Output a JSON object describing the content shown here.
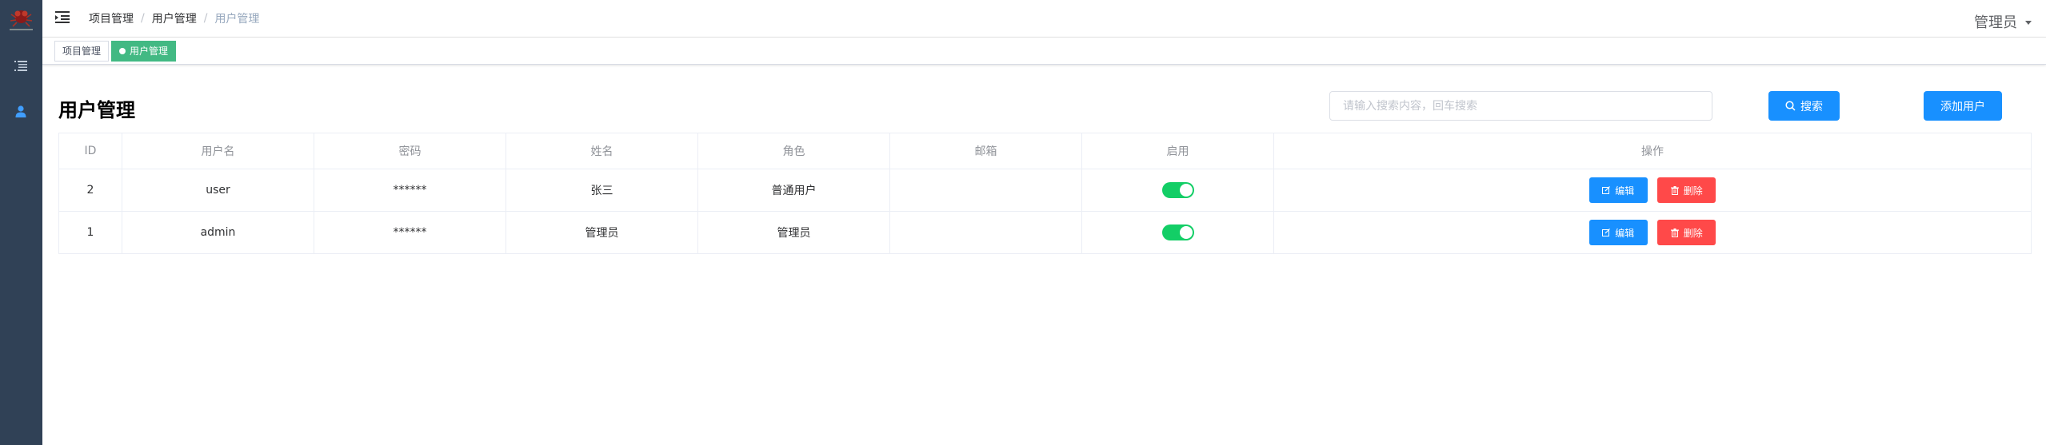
{
  "breadcrumb": [
    "项目管理",
    "用户管理",
    "用户管理"
  ],
  "user_menu": {
    "label": "管理员"
  },
  "tags": [
    {
      "label": "项目管理",
      "active": false
    },
    {
      "label": "用户管理",
      "active": true
    }
  ],
  "page": {
    "title": "用户管理"
  },
  "search": {
    "placeholder": "请输入搜索内容，回车搜索",
    "button_label": "搜索"
  },
  "add_button_label": "添加用户",
  "table": {
    "headers": [
      "ID",
      "用户名",
      "密码",
      "姓名",
      "角色",
      "邮箱",
      "启用",
      "操作"
    ],
    "rows": [
      {
        "id": "2",
        "username": "user",
        "password": "******",
        "name": "张三",
        "role": "普通用户",
        "email": "",
        "enabled": true
      },
      {
        "id": "1",
        "username": "admin",
        "password": "******",
        "name": "管理员",
        "role": "管理员",
        "email": "",
        "enabled": true
      }
    ],
    "edit_label": "编辑",
    "delete_label": "删除"
  },
  "colors": {
    "sidebar": "#304156",
    "primary": "#1890ff",
    "danger": "#ff4949",
    "tag_active": "#42b983",
    "switch_on": "#13ce66"
  },
  "icons": {
    "sidebar": [
      "menu-list-icon",
      "user-icon"
    ],
    "toolbar": "hamburger-icon"
  }
}
